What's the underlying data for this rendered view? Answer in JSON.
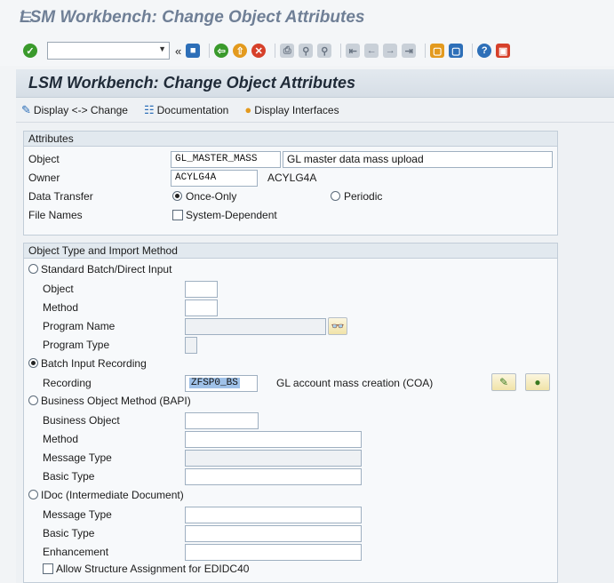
{
  "window": {
    "title": "LSM Workbench: Change Object Attributes"
  },
  "toolbar": {
    "command_value": "",
    "icons": [
      "enter-icon",
      "save-icon",
      "back-icon",
      "exit-icon",
      "cancel-icon",
      "print-icon",
      "find-icon",
      "find-next-icon",
      "first-page-icon",
      "prev-page-icon",
      "next-page-icon",
      "last-page-icon",
      "new-session-icon",
      "shortcut-icon",
      "help-icon",
      "customize-icon"
    ],
    "colors": {
      "green": "#3a9a2c",
      "orange": "#e39a1e",
      "red": "#d6402a",
      "blue": "#2d6fb8"
    }
  },
  "screen": {
    "title": "LSM Workbench: Change Object Attributes",
    "buttons": {
      "display_change": "Display <-> Change",
      "documentation": "Documentation",
      "display_interfaces": "Display Interfaces"
    }
  },
  "attributes": {
    "header": "Attributes",
    "object_label": "Object",
    "object_value": "GL_MASTER_MASS",
    "object_desc": "GL  master data mass upload",
    "owner_label": "Owner",
    "owner_value": "ACYLG4A",
    "owner_desc": "ACYLG4A",
    "data_transfer_label": "Data Transfer",
    "once_only": "Once-Only",
    "periodic": "Periodic",
    "file_names_label": "File Names",
    "system_dependent": "System-Dependent"
  },
  "import": {
    "header": "Object Type and Import Method",
    "standard_batch": "Standard Batch/Direct Input",
    "object_label": "Object",
    "method_label": "Method",
    "program_name_label": "Program Name",
    "program_type_label": "Program Type",
    "batch_input_recording": "Batch Input Recording",
    "recording_label": "Recording",
    "recording_value": "ZFSP0_BS",
    "recording_desc": "GL account mass creation (COA)",
    "bapi": "Business Object Method  (BAPI)",
    "business_object_label": "Business Object",
    "bapi_method_label": "Method",
    "message_type_label": "Message Type",
    "basic_type_label": "Basic Type",
    "idoc": "IDoc (Intermediate Document)",
    "idoc_message_type_label": "Message Type",
    "idoc_basic_type_label": "Basic Type",
    "enhancement_label": "Enhancement",
    "allow_structure": "Allow Structure Assignment for EDIDC40"
  }
}
